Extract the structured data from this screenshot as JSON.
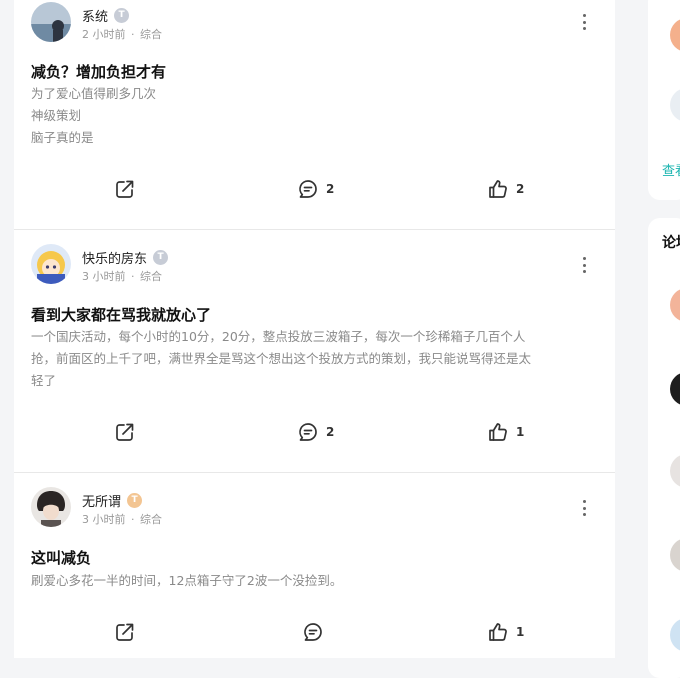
{
  "posts": [
    {
      "username": "系统",
      "badge": "T",
      "time": "2 小时前",
      "category": "综合",
      "title": "减负？增加负担才有",
      "body": [
        "为了爱心值得刷多几次",
        "神级策划",
        "脑子真的是"
      ],
      "comments": "2",
      "likes": "2"
    },
    {
      "username": "快乐的房东",
      "badge": "T",
      "time": "3 小时前",
      "category": "综合",
      "title": "看到大家都在骂我就放心了",
      "body": [
        "一个国庆活动，每个小时的10分，20分，整点投放三波箱子，每次一个珍稀箱子几百个人",
        "抢，前面区的上千了吧，满世界全是骂这个想出这个投放方式的策划，我只能说骂得还是太",
        "轻了"
      ],
      "comments": "2",
      "likes": "1"
    },
    {
      "username": "无所谓",
      "badge": "T",
      "time": "3 小时前",
      "category": "综合",
      "title": "这叫减负",
      "body": [
        "刷爱心多花一半的时间，12点箱子守了2波一个没捡到。"
      ],
      "comments": "",
      "likes": "1"
    }
  ],
  "sidebar": {
    "link": "查看",
    "section_title": "论坛"
  },
  "colors": {
    "accent": "#1bb5b0",
    "text_muted": "#8a8a8a",
    "badge_grey": "#c7ccd6",
    "badge_orange": "#f3c592"
  },
  "icons": [
    "more-icon",
    "share-icon",
    "comment-icon",
    "like-icon"
  ]
}
